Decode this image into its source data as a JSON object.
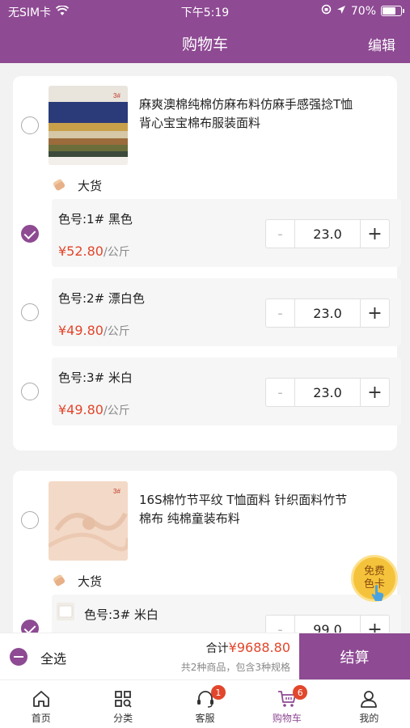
{
  "status_bar": {
    "carrier": "无SIM卡",
    "time": "下午5:19",
    "battery": "70%"
  },
  "nav": {
    "title": "购物车",
    "edit": "编辑"
  },
  "items": [
    {
      "name_line1": "麻爽澳棉纯棉仿麻布料仿麻手感强捻T恤",
      "name_line2": "背心宝宝棉布服装面料",
      "batch": "大货",
      "specs": [
        {
          "label": "色号:1# 黑色",
          "price": "¥52.80",
          "unit": "/公斤",
          "qty": "23.0"
        },
        {
          "label": "色号:2# 漂白色",
          "price": "¥49.80",
          "unit": "/公斤",
          "qty": "23.0"
        },
        {
          "label": "色号:3# 米白",
          "price": "¥49.80",
          "unit": "/公斤",
          "qty": "23.0"
        }
      ]
    },
    {
      "name_line1": "16S棉竹节平纹 T恤面料 针织面料竹节",
      "name_line2": "棉布 纯棉童装布料",
      "batch": "大货",
      "specs": [
        {
          "label": "色号:3# 米白",
          "qty": "99.0"
        }
      ]
    }
  ],
  "stepper": {
    "minus": "-",
    "plus": "+"
  },
  "footer": {
    "select_all": "全选",
    "total_label": "合计",
    "total_amount": "¥9688.80",
    "summary": "共2种商品，包含3种规格",
    "checkout": "结算"
  },
  "free_card": {
    "line1": "免费",
    "line2": "色卡"
  },
  "tabs": [
    {
      "label": "首页",
      "icon": "home-icon"
    },
    {
      "label": "分类",
      "icon": "category-icon"
    },
    {
      "label": "客服",
      "icon": "headset-icon",
      "badge": "1"
    },
    {
      "label": "购物车",
      "icon": "cart-icon",
      "badge": "6",
      "active": true
    },
    {
      "label": "我的",
      "icon": "user-icon"
    }
  ],
  "colors": {
    "brand": "#8e4a93",
    "price": "#e2462b",
    "badge": "#e2462b",
    "free_card": "#f5c33b"
  }
}
